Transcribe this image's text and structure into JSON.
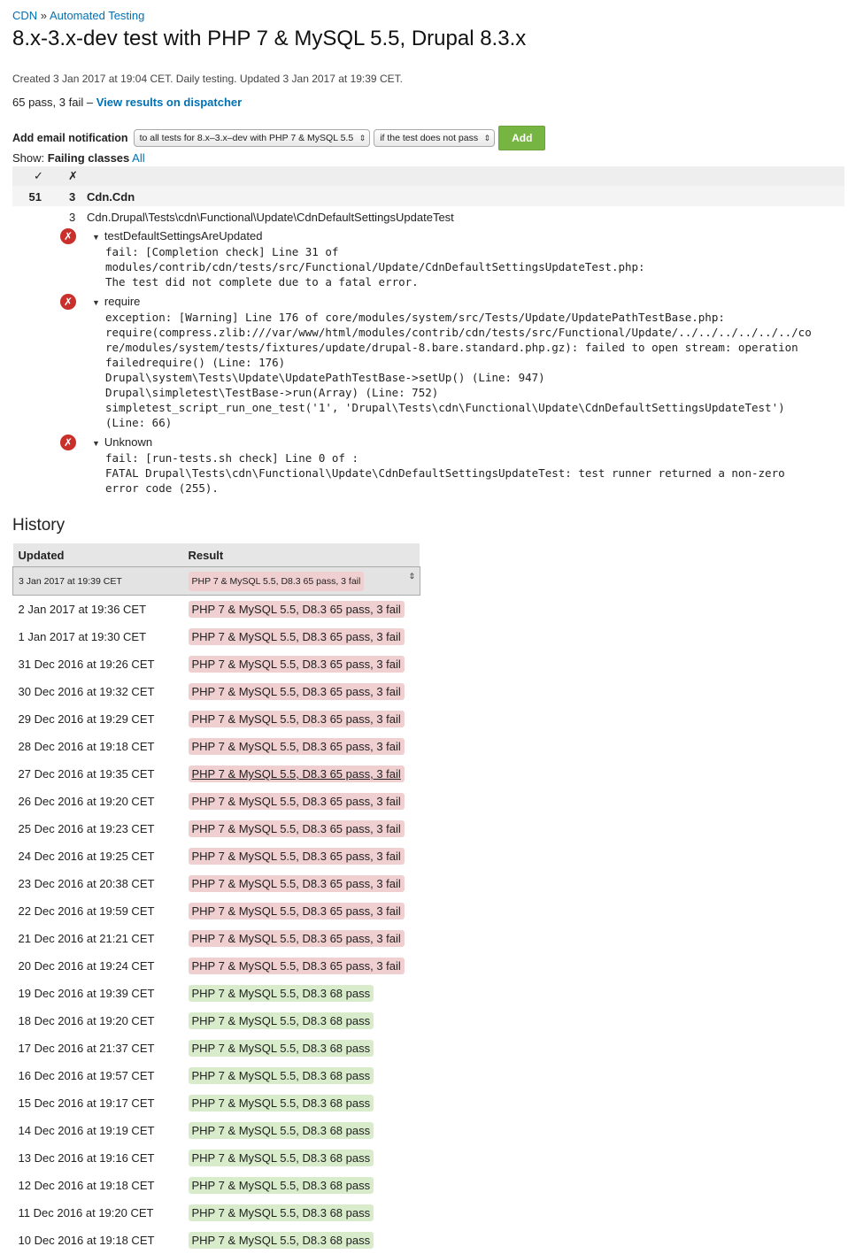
{
  "breadcrumb": {
    "root": "CDN",
    "sep": "»",
    "current": "Automated Testing"
  },
  "title": "8.x-3.x-dev test with PHP 7 & MySQL 5.5, Drupal 8.3.x",
  "meta": "Created 3 Jan 2017 at 19:04 CET. Daily testing. Updated 3 Jan 2017 at 19:39 CET.",
  "summary": {
    "text": "65 pass, 3 fail –",
    "link": "View results on dispatcher"
  },
  "notify": {
    "label": "Add email notification",
    "scope": "to all tests for 8.x–3.x–dev with PHP 7 & MySQL 5.5",
    "condition": "if the test does not pass",
    "button": "Add"
  },
  "show": {
    "label": "Show:",
    "current": "Failing classes",
    "all": "All"
  },
  "results": {
    "head_pass": "✓",
    "head_fail": "✗",
    "group": {
      "pass": "51",
      "fail": "3",
      "name": "Cdn.Cdn"
    },
    "class": {
      "fail": "3",
      "name": "Cdn.Drupal\\Tests\\cdn\\Functional\\Update\\CdnDefaultSettingsUpdateTest"
    },
    "cases": [
      {
        "name": "testDefaultSettingsAreUpdated",
        "message": "fail: [Completion check] Line 31 of\nmodules/contrib/cdn/tests/src/Functional/Update/CdnDefaultSettingsUpdateTest.php:\nThe test did not complete due to a fatal error."
      },
      {
        "name": "require",
        "message": "exception: [Warning] Line 176 of core/modules/system/src/Tests/Update/UpdatePathTestBase.php:\nrequire(compress.zlib:///var/www/html/modules/contrib/cdn/tests/src/Functional/Update/../../../../../../co\nre/modules/system/tests/fixtures/update/drupal-8.bare.standard.php.gz): failed to open stream: operation\nfailedrequire() (Line: 176)\nDrupal\\system\\Tests\\Update\\UpdatePathTestBase->setUp() (Line: 947)\nDrupal\\simpletest\\TestBase->run(Array) (Line: 752)\nsimpletest_script_run_one_test('1', 'Drupal\\Tests\\cdn\\Functional\\Update\\CdnDefaultSettingsUpdateTest')\n(Line: 66)"
      },
      {
        "name": "Unknown",
        "message": "fail: [run-tests.sh check] Line 0 of :\nFATAL Drupal\\Tests\\cdn\\Functional\\Update\\CdnDefaultSettingsUpdateTest: test runner returned a non-zero\nerror code (255)."
      }
    ]
  },
  "history": {
    "heading": "History",
    "col_updated": "Updated",
    "col_result": "Result",
    "rows": [
      {
        "date": "3 Jan 2017 at 19:39 CET",
        "result": "PHP 7 & MySQL 5.5, D8.3 65 pass, 3 fail",
        "status": "fail"
      },
      {
        "date": "2 Jan 2017 at 19:36 CET",
        "result": "PHP 7 & MySQL 5.5, D8.3 65 pass, 3 fail",
        "status": "fail"
      },
      {
        "date": "1 Jan 2017 at 19:30 CET",
        "result": "PHP 7 & MySQL 5.5, D8.3 65 pass, 3 fail",
        "status": "fail"
      },
      {
        "date": "31 Dec 2016 at 19:26 CET",
        "result": "PHP 7 & MySQL 5.5, D8.3 65 pass, 3 fail",
        "status": "fail"
      },
      {
        "date": "30 Dec 2016 at 19:32 CET",
        "result": "PHP 7 & MySQL 5.5, D8.3 65 pass, 3 fail",
        "status": "fail"
      },
      {
        "date": "29 Dec 2016 at 19:29 CET",
        "result": "PHP 7 & MySQL 5.5, D8.3 65 pass, 3 fail",
        "status": "fail"
      },
      {
        "date": "28 Dec 2016 at 19:18 CET",
        "result": "PHP 7 & MySQL 5.5, D8.3 65 pass, 3 fail",
        "status": "fail"
      },
      {
        "date": "27 Dec 2016 at 19:35 CET",
        "result": "PHP 7 & MySQL 5.5, D8.3 65 pass, 3 fail",
        "status": "fail"
      },
      {
        "date": "26 Dec 2016 at 19:20 CET",
        "result": "PHP 7 & MySQL 5.5, D8.3 65 pass, 3 fail",
        "status": "fail"
      },
      {
        "date": "25 Dec 2016 at 19:23 CET",
        "result": "PHP 7 & MySQL 5.5, D8.3 65 pass, 3 fail",
        "status": "fail"
      },
      {
        "date": "24 Dec 2016 at 19:25 CET",
        "result": "PHP 7 & MySQL 5.5, D8.3 65 pass, 3 fail",
        "status": "fail"
      },
      {
        "date": "23 Dec 2016 at 20:38 CET",
        "result": "PHP 7 & MySQL 5.5, D8.3 65 pass, 3 fail",
        "status": "fail"
      },
      {
        "date": "22 Dec 2016 at 19:59 CET",
        "result": "PHP 7 & MySQL 5.5, D8.3 65 pass, 3 fail",
        "status": "fail"
      },
      {
        "date": "21 Dec 2016 at 21:21 CET",
        "result": "PHP 7 & MySQL 5.5, D8.3 65 pass, 3 fail",
        "status": "fail"
      },
      {
        "date": "20 Dec 2016 at 19:24 CET",
        "result": "PHP 7 & MySQL 5.5, D8.3 65 pass, 3 fail",
        "status": "fail"
      },
      {
        "date": "19 Dec 2016 at 19:39 CET",
        "result": "PHP 7 & MySQL 5.5, D8.3 68 pass",
        "status": "pass"
      },
      {
        "date": "18 Dec 2016 at 19:20 CET",
        "result": "PHP 7 & MySQL 5.5, D8.3 68 pass",
        "status": "pass"
      },
      {
        "date": "17 Dec 2016 at 21:37 CET",
        "result": "PHP 7 & MySQL 5.5, D8.3 68 pass",
        "status": "pass"
      },
      {
        "date": "16 Dec 2016 at 19:57 CET",
        "result": "PHP 7 & MySQL 5.5, D8.3 68 pass",
        "status": "pass"
      },
      {
        "date": "15 Dec 2016 at 19:17 CET",
        "result": "PHP 7 & MySQL 5.5, D8.3 68 pass",
        "status": "pass"
      },
      {
        "date": "14 Dec 2016 at 19:19 CET",
        "result": "PHP 7 & MySQL 5.5, D8.3 68 pass",
        "status": "pass"
      },
      {
        "date": "13 Dec 2016 at 19:16 CET",
        "result": "PHP 7 & MySQL 5.5, D8.3 68 pass",
        "status": "pass"
      },
      {
        "date": "12 Dec 2016 at 19:18 CET",
        "result": "PHP 7 & MySQL 5.5, D8.3 68 pass",
        "status": "pass"
      },
      {
        "date": "11 Dec 2016 at 19:20 CET",
        "result": "PHP 7 & MySQL 5.5, D8.3 68 pass",
        "status": "pass"
      },
      {
        "date": "10 Dec 2016 at 19:18 CET",
        "result": "PHP 7 & MySQL 5.5, D8.3 68 pass",
        "status": "pass"
      }
    ]
  },
  "colors": {
    "link": "#0071b3",
    "add_button": "#77b542",
    "fail_bg": "#f0cfd0",
    "pass_bg": "#d8eccb",
    "error_icon": "#c9302c"
  },
  "icons": {
    "case_status": "error-x-icon",
    "expand": "triangle-down-icon"
  }
}
